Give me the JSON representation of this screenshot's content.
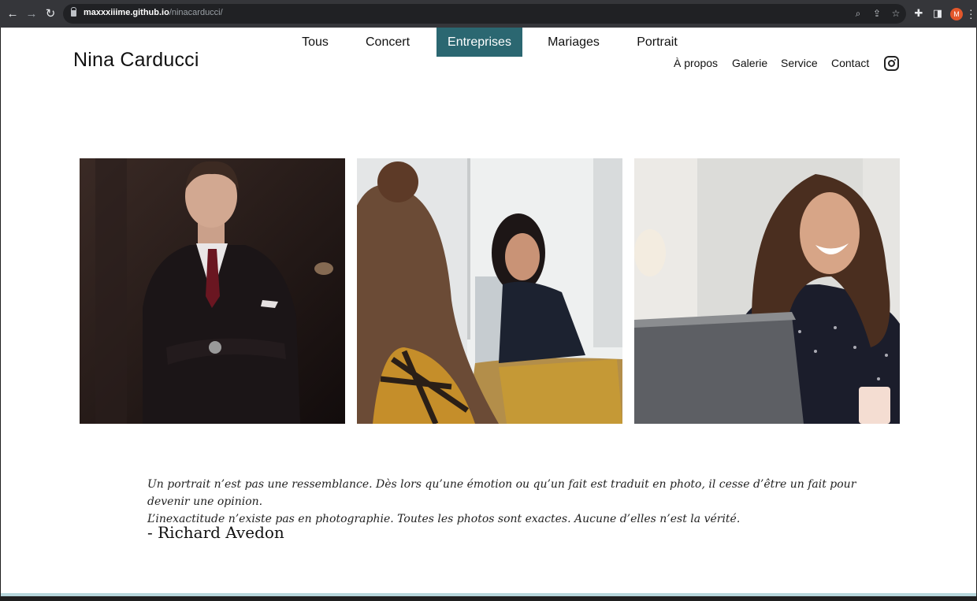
{
  "browser": {
    "url_host": "maxxxiiime.github.io",
    "url_path": "/ninacarducci/",
    "profile_initial": "M",
    "icons": [
      "back-icon",
      "forward-icon",
      "reload-icon",
      "lock-icon",
      "zoom-icon",
      "share-icon",
      "bookmark-star-icon",
      "extensions-icon",
      "sidepanel-icon",
      "menu-icon"
    ]
  },
  "site": {
    "brand": "Nina Carducci",
    "nav": [
      "À propos",
      "Galerie",
      "Service",
      "Contact"
    ],
    "social_icon": "instagram-icon"
  },
  "gallery": {
    "filters": [
      "Tous",
      "Concert",
      "Entreprises",
      "Mariages",
      "Portrait"
    ],
    "active_filter": "Entreprises",
    "accent_color": "#2b6771",
    "photos": [
      "photo-businessman",
      "photo-meeting-woman",
      "photo-laughing-woman-laptop"
    ]
  },
  "quote": {
    "line1": "Un portrait n’est pas une ressemblance. Dès lors qu’une émotion ou qu’un fait est traduit en photo, il cesse d’être un fait pour devenir une opinion.",
    "line2": "L’inexactitude n’existe pas en photographie. Toutes les photos sont exactes. Aucune d’elles n’est la vérité.",
    "author": "- Richard Avedon"
  }
}
